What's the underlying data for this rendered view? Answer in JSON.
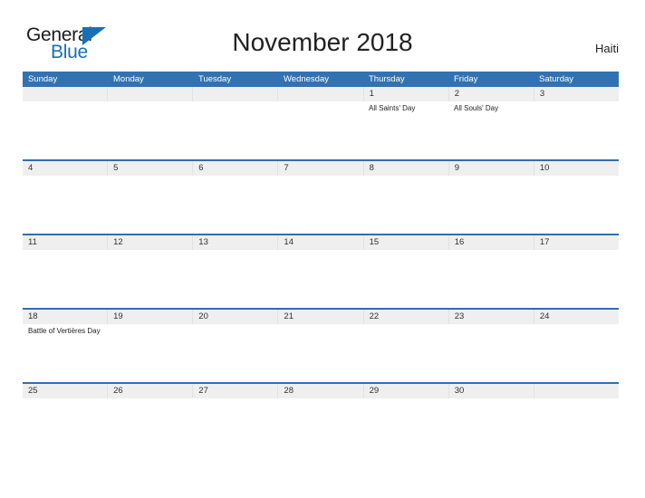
{
  "branding": {
    "logo_line1": "General",
    "logo_line2": "Blue",
    "logo_icon": "triangle-flag-icon",
    "brand_color": "#1670b8"
  },
  "header": {
    "title": "November 2018",
    "country": "Haiti"
  },
  "calendar": {
    "header_background": "#3272b3",
    "date_strip_background": "#efefef",
    "divider_color": "#2f6fb0",
    "weekdays": [
      "Sunday",
      "Monday",
      "Tuesday",
      "Wednesday",
      "Thursday",
      "Friday",
      "Saturday"
    ],
    "weeks": [
      {
        "days": [
          {
            "date": "",
            "events": []
          },
          {
            "date": "",
            "events": []
          },
          {
            "date": "",
            "events": []
          },
          {
            "date": "",
            "events": []
          },
          {
            "date": "1",
            "events": [
              "All Saints' Day"
            ]
          },
          {
            "date": "2",
            "events": [
              "All Souls' Day"
            ]
          },
          {
            "date": "3",
            "events": []
          }
        ]
      },
      {
        "days": [
          {
            "date": "4",
            "events": []
          },
          {
            "date": "5",
            "events": []
          },
          {
            "date": "6",
            "events": []
          },
          {
            "date": "7",
            "events": []
          },
          {
            "date": "8",
            "events": []
          },
          {
            "date": "9",
            "events": []
          },
          {
            "date": "10",
            "events": []
          }
        ]
      },
      {
        "days": [
          {
            "date": "11",
            "events": []
          },
          {
            "date": "12",
            "events": []
          },
          {
            "date": "13",
            "events": []
          },
          {
            "date": "14",
            "events": []
          },
          {
            "date": "15",
            "events": []
          },
          {
            "date": "16",
            "events": []
          },
          {
            "date": "17",
            "events": []
          }
        ]
      },
      {
        "days": [
          {
            "date": "18",
            "events": [
              "Battle of Vertières Day"
            ]
          },
          {
            "date": "19",
            "events": []
          },
          {
            "date": "20",
            "events": []
          },
          {
            "date": "21",
            "events": []
          },
          {
            "date": "22",
            "events": []
          },
          {
            "date": "23",
            "events": []
          },
          {
            "date": "24",
            "events": []
          }
        ]
      },
      {
        "days": [
          {
            "date": "25",
            "events": []
          },
          {
            "date": "26",
            "events": []
          },
          {
            "date": "27",
            "events": []
          },
          {
            "date": "28",
            "events": []
          },
          {
            "date": "29",
            "events": []
          },
          {
            "date": "30",
            "events": []
          },
          {
            "date": "",
            "events": []
          }
        ]
      }
    ]
  }
}
